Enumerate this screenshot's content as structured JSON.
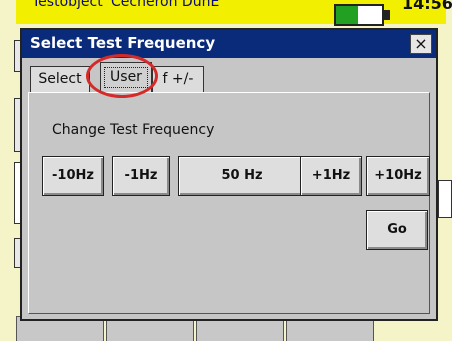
{
  "background": {
    "title": "Testobject 'Cecheron DunE'",
    "time": "14:56"
  },
  "dialog": {
    "title": "Select Test Frequency",
    "close_label": "×",
    "tabs": [
      {
        "label": "Select"
      },
      {
        "label": "User"
      },
      {
        "label": "f +/-"
      }
    ],
    "change_label": "Change Test Frequency",
    "buttons": {
      "minus10": "-10Hz",
      "minus1": "-1Hz",
      "value": "50 Hz",
      "plus1": "+1Hz",
      "plus10": "+10Hz",
      "go": "Go"
    }
  }
}
